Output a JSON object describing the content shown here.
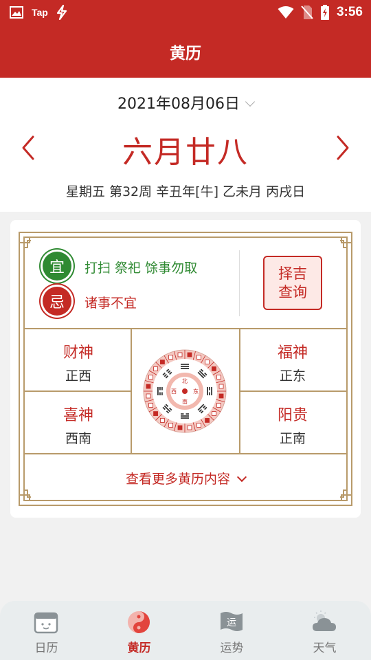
{
  "status_bar": {
    "carrier_app": "Tap",
    "time": "3:56",
    "icons": [
      "gallery-icon",
      "tap-icon",
      "lightning-app-icon",
      "wifi-icon",
      "no-sim-icon",
      "battery-charging-icon"
    ]
  },
  "appbar": {
    "title": "黄历"
  },
  "header": {
    "date": "2021年08月06日",
    "lunar_date": "六月廿八",
    "ganzhi": "星期五 第32周 辛丑年[牛] 乙未月 丙戌日"
  },
  "almanac": {
    "yi_label": "宜",
    "yi_text": "打扫 祭祀 馀事勿取",
    "ji_label": "忌",
    "ji_text": "诸事不宜",
    "zeji_button": [
      "择吉",
      "查询"
    ],
    "gods": [
      {
        "title": "财神",
        "value": "正西"
      },
      {
        "title": "福神",
        "value": "正东"
      },
      {
        "title": "喜神",
        "value": "西南"
      },
      {
        "title": "阳贵",
        "value": "正南"
      }
    ],
    "compass_center": [
      "北",
      "南",
      "西",
      "东"
    ],
    "more_label": "查看更多黄历内容"
  },
  "tabs": [
    {
      "label": "日历",
      "icon": "calendar-face-icon",
      "active": false
    },
    {
      "label": "黄历",
      "icon": "yin-yang-icon",
      "active": true
    },
    {
      "label": "运势",
      "icon": "fortune-flag-icon",
      "active": false,
      "icon_text": "运"
    },
    {
      "label": "天气",
      "icon": "weather-cloud-icon",
      "active": false
    }
  ],
  "colors": {
    "primary": "#c42a25",
    "yi_green": "#2f8a32",
    "frame_gold": "#b89a6a"
  }
}
